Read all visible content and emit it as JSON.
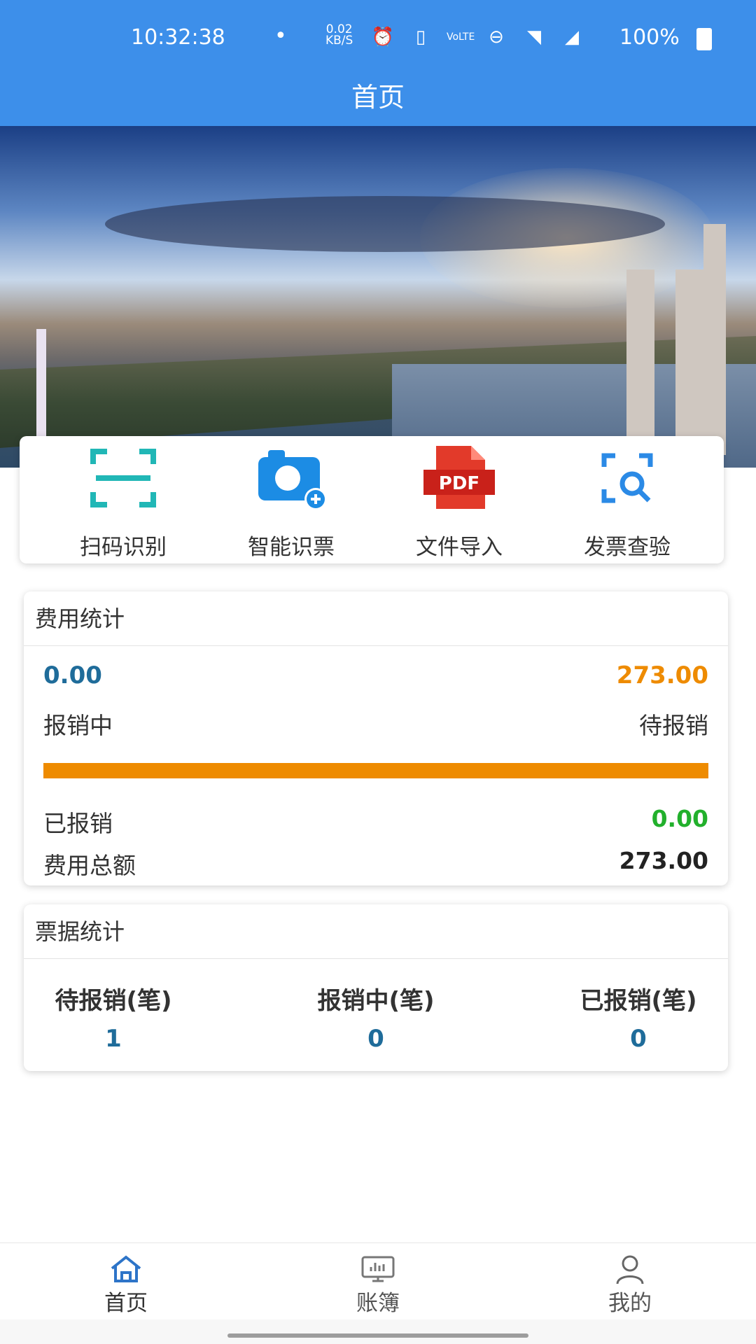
{
  "status_bar": {
    "time": "10:32:38",
    "net_speed_value": "0.02",
    "net_speed_unit": "KB/S",
    "battery": "100%"
  },
  "header": {
    "title": "首页"
  },
  "quick_actions": [
    {
      "label": "扫码识别",
      "icon": "scan-icon"
    },
    {
      "label": "智能识票",
      "icon": "camera-add-icon"
    },
    {
      "label": "文件导入",
      "icon": "pdf-icon"
    },
    {
      "label": "发票查验",
      "icon": "search-scan-icon"
    }
  ],
  "pdf_icon_text": "PDF",
  "fee_stats": {
    "title": "费用统计",
    "in_progress_amount": "0.00",
    "in_progress_label": "报销中",
    "pending_amount": "273.00",
    "pending_label": "待报销",
    "pending_share": 1.0,
    "reimbursed_label": "已报销",
    "reimbursed_amount": "0.00",
    "total_label": "费用总额",
    "total_amount": "273.00",
    "colors": {
      "in_progress": "#1f6c9a",
      "pending": "#ee8b00",
      "reimbursed": "#22b02c"
    }
  },
  "bill_stats": {
    "title": "票据统计",
    "columns": [
      {
        "label": "待报销(笔)",
        "value": "1"
      },
      {
        "label": "报销中(笔)",
        "value": "0"
      },
      {
        "label": "已报销(笔)",
        "value": "0"
      }
    ]
  },
  "tabbar": {
    "items": [
      {
        "label": "首页",
        "icon": "home-icon",
        "active": true
      },
      {
        "label": "账簿",
        "icon": "ledger-icon",
        "active": false
      },
      {
        "label": "我的",
        "icon": "user-icon",
        "active": false
      }
    ],
    "active_color": "#333333",
    "inactive_color": "#666666"
  },
  "accent_color": "#3d8fea"
}
